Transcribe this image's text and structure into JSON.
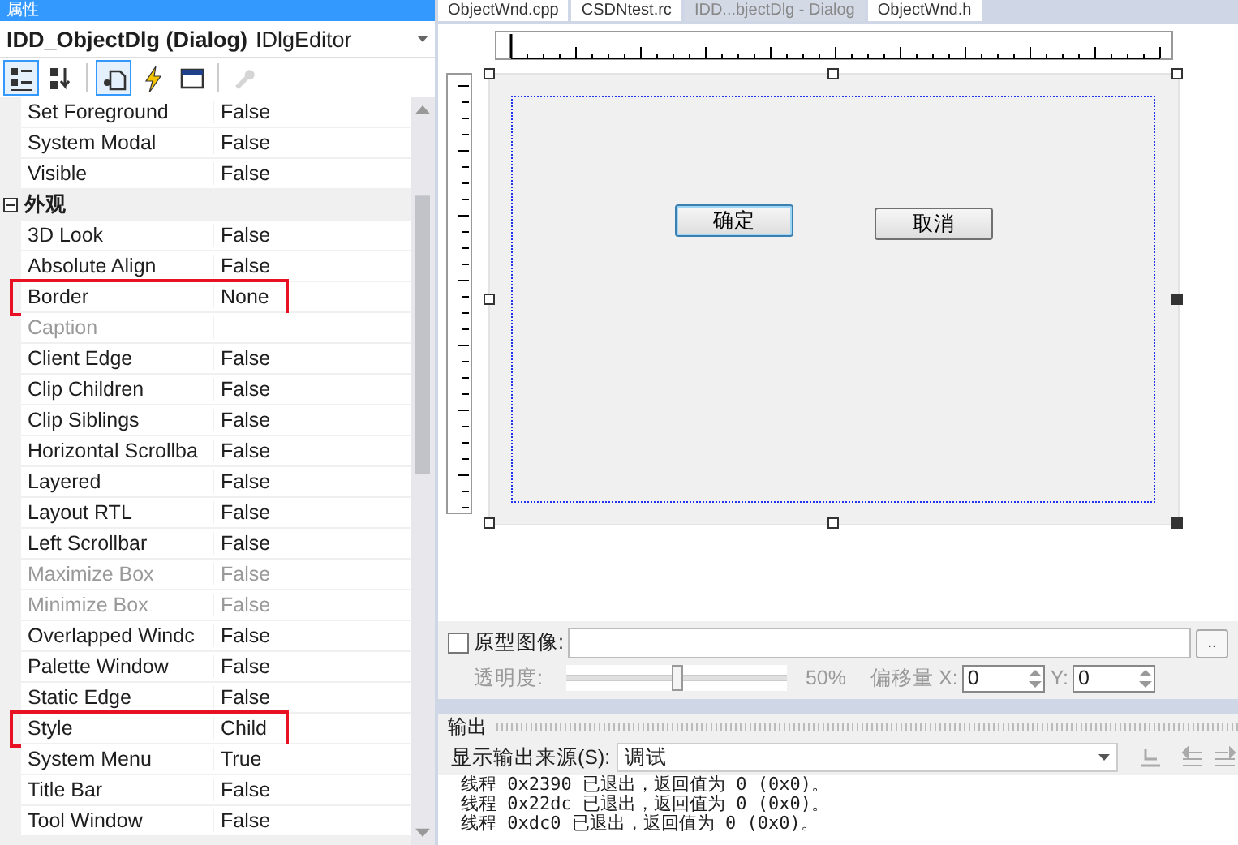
{
  "properties_panel": {
    "title": "属性",
    "object": {
      "name": "IDD_ObjectDlg (Dialog)",
      "type": "IDlgEditor"
    },
    "toolbar": [
      {
        "kind": "categorized",
        "selected": true,
        "disabled": false
      },
      {
        "kind": "alphabetical",
        "selected": false,
        "disabled": false
      },
      {
        "kind": "properties",
        "selected": true,
        "disabled": false
      },
      {
        "kind": "events",
        "selected": false,
        "disabled": false
      },
      {
        "kind": "messages",
        "selected": false,
        "disabled": false
      },
      {
        "kind": "overrides",
        "selected": false,
        "disabled": true
      }
    ],
    "rows": [
      {
        "kind": "property",
        "name": "Set Foreground",
        "value": "False",
        "disabled": false,
        "highlighted": false
      },
      {
        "kind": "property",
        "name": "System Modal",
        "value": "False",
        "disabled": false,
        "highlighted": false
      },
      {
        "kind": "property",
        "name": "Visible",
        "value": "False",
        "disabled": false,
        "highlighted": false
      },
      {
        "kind": "category",
        "name": "外观",
        "expanded": true
      },
      {
        "kind": "property",
        "name": "3D Look",
        "value": "False",
        "disabled": false,
        "highlighted": false
      },
      {
        "kind": "property",
        "name": "Absolute Align",
        "value": "False",
        "disabled": false,
        "highlighted": false
      },
      {
        "kind": "property",
        "name": "Border",
        "value": "None",
        "disabled": false,
        "highlighted": true
      },
      {
        "kind": "property",
        "name": "Caption",
        "disabled": true,
        "highlighted": false
      },
      {
        "kind": "property",
        "name": "Client Edge",
        "value": "False",
        "disabled": false,
        "highlighted": false
      },
      {
        "kind": "property",
        "name": "Clip Children",
        "value": "False",
        "disabled": false,
        "highlighted": false
      },
      {
        "kind": "property",
        "name": "Clip Siblings",
        "value": "False",
        "disabled": false,
        "highlighted": false
      },
      {
        "kind": "property",
        "name": "Horizontal Scrollba",
        "value": "False",
        "disabled": false,
        "highlighted": false
      },
      {
        "kind": "property",
        "name": "Layered",
        "value": "False",
        "disabled": false,
        "highlighted": false
      },
      {
        "kind": "property",
        "name": "Layout RTL",
        "value": "False",
        "disabled": false,
        "highlighted": false
      },
      {
        "kind": "property",
        "name": "Left Scrollbar",
        "value": "False",
        "disabled": false,
        "highlighted": false
      },
      {
        "kind": "property",
        "name": "Maximize Box",
        "value": "False",
        "disabled": true,
        "highlighted": false
      },
      {
        "kind": "property",
        "name": "Minimize Box",
        "value": "False",
        "disabled": true,
        "highlighted": false
      },
      {
        "kind": "property",
        "name": "Overlapped Windc",
        "value": "False",
        "disabled": false,
        "highlighted": false
      },
      {
        "kind": "property",
        "name": "Palette Window",
        "value": "False",
        "disabled": false,
        "highlighted": false
      },
      {
        "kind": "property",
        "name": "Static Edge",
        "value": "False",
        "disabled": false,
        "highlighted": false
      },
      {
        "kind": "property",
        "name": "Style",
        "value": "Child",
        "disabled": false,
        "highlighted": true
      },
      {
        "kind": "property",
        "name": "System Menu",
        "value": "True",
        "disabled": false,
        "highlighted": false
      },
      {
        "kind": "property",
        "name": "Title Bar",
        "value": "False",
        "disabled": false,
        "highlighted": false
      },
      {
        "kind": "property",
        "name": "Tool Window",
        "value": "False",
        "disabled": false,
        "highlighted": false
      }
    ]
  },
  "document_tabs": [
    {
      "label": "ObjectWnd.cpp",
      "selected": false
    },
    {
      "label": "CSDNtest.rc",
      "selected": false
    },
    {
      "label": "IDD...bjectDlg - Dialog",
      "selected": true
    },
    {
      "label": "ObjectWnd.h",
      "selected": false
    }
  ],
  "dialog": {
    "buttons": [
      {
        "label": "确定",
        "focused": true
      },
      {
        "label": "取消",
        "focused": false
      }
    ]
  },
  "prototype_image": {
    "checked": false,
    "label": "原型图像:",
    "browse": "..",
    "opacity_label": "透明度:",
    "opacity": {
      "level": 0.5,
      "reading": "50%"
    },
    "offset_label": "偏移量",
    "x_label": "X:",
    "x_value": "0",
    "y_label": "Y:",
    "y_value": "0"
  },
  "output": {
    "title": "输出",
    "source_label": "显示输出来源(S):",
    "source_value": "调试",
    "lines": [
      "线程 0x2390 已退出，返回值为 0 (0x0)。",
      "线程 0x22dc 已退出，返回值为 0 (0x0)。",
      "线程 0xdc0 已退出，返回值为 0 (0x0)。"
    ]
  }
}
